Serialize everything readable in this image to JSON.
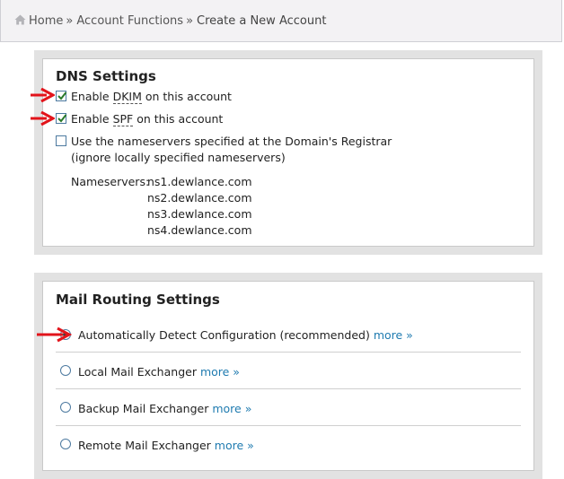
{
  "breadcrumb": {
    "home": "Home",
    "separator": "»",
    "account_functions": "Account Functions",
    "current": "Create a New Account"
  },
  "dns": {
    "title": "DNS Settings",
    "dkim": {
      "pre": "Enable ",
      "abbr": "DKIM",
      "post": " on this account",
      "checked": true
    },
    "spf": {
      "pre": "Enable ",
      "abbr": "SPF",
      "post": " on this account",
      "checked": true
    },
    "registrar": {
      "line1": "Use the nameservers specified at the Domain's Registrar",
      "line2": "(ignore locally specified nameservers)",
      "checked": false
    },
    "nameservers_label": "Nameservers:",
    "nameservers": [
      "ns1.dewlance.com",
      "ns2.dewlance.com",
      "ns3.dewlance.com",
      "ns4.dewlance.com"
    ]
  },
  "mail": {
    "title": "Mail Routing Settings",
    "more_label": "more »",
    "options": [
      {
        "label": "Automatically Detect Configuration (recommended)",
        "checked": true
      },
      {
        "label": "Local Mail Exchanger",
        "checked": false
      },
      {
        "label": "Backup Mail Exchanger",
        "checked": false
      },
      {
        "label": "Remote Mail Exchanger",
        "checked": false
      }
    ]
  },
  "colors": {
    "annotation_arrow": "#e2141b",
    "link": "#1f7bb0",
    "checkbox_border": "#4d7aa0"
  }
}
